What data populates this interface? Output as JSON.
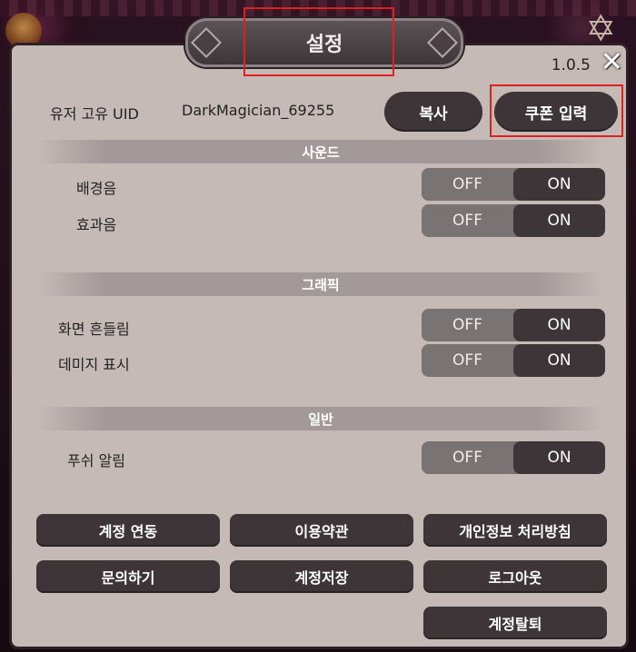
{
  "title": "설정",
  "version": "1.0.5",
  "uid": {
    "label": "유저 고유 UID",
    "value": "DarkMagician_69255",
    "copy_label": "복사",
    "coupon_label": "쿠폰 입력"
  },
  "sections": {
    "sound": {
      "title": "사운드",
      "rows": [
        {
          "label": "배경음",
          "off": "OFF",
          "on": "ON",
          "state": "ON"
        },
        {
          "label": "효과음",
          "off": "OFF",
          "on": "ON",
          "state": "ON"
        }
      ]
    },
    "graphics": {
      "title": "그래픽",
      "rows": [
        {
          "label": "화면 흔들림",
          "off": "OFF",
          "on": "ON",
          "state": "ON"
        },
        {
          "label": "데미지 표시",
          "off": "OFF",
          "on": "ON",
          "state": "ON"
        }
      ]
    },
    "general": {
      "title": "일반",
      "rows": [
        {
          "label": "푸쉬 알림",
          "off": "OFF",
          "on": "ON",
          "state": "ON"
        }
      ]
    }
  },
  "buttons": {
    "account_link": "계정 연동",
    "terms": "이용약관",
    "privacy": "개인정보 처리방침",
    "inquiry": "문의하기",
    "account_save": "계정저장",
    "logout": "로그아웃",
    "withdraw": "계정탈퇴"
  },
  "colors": {
    "panel": "#c6bab6",
    "button": "#3d3538",
    "highlight": "#e02020"
  }
}
